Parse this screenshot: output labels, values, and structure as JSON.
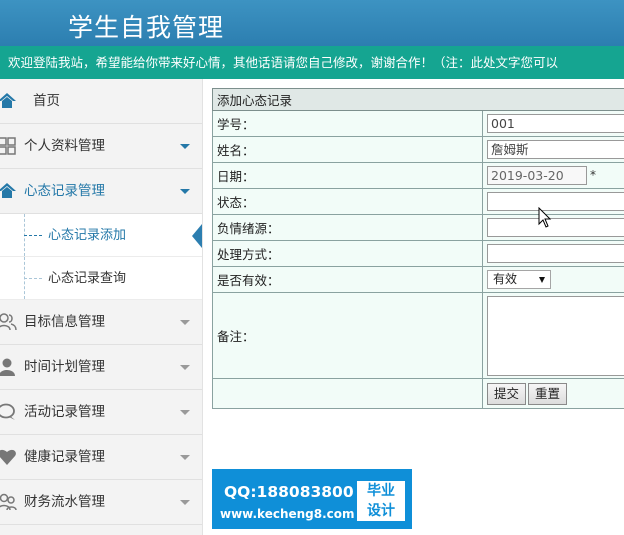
{
  "header": {
    "title": "学生自我管理"
  },
  "marquee": {
    "text": "欢迎登陆我站，希望能给你带来好心情，其他话语请您自己修改，谢谢合作！（注：此处文字您可以"
  },
  "sidebar": {
    "items": [
      {
        "label": "首页",
        "icon": "home-icon"
      },
      {
        "label": "个人资料管理",
        "icon": "grid-icon"
      },
      {
        "label": "心态记录管理",
        "icon": "home-icon"
      },
      {
        "label": "目标信息管理",
        "icon": "users-icon"
      },
      {
        "label": "时间计划管理",
        "icon": "user-icon"
      },
      {
        "label": "活动记录管理",
        "icon": "chat-icon"
      },
      {
        "label": "健康记录管理",
        "icon": "heart-icon"
      },
      {
        "label": "财务流水管理",
        "icon": "user-group-icon"
      }
    ],
    "sub_items": [
      {
        "label": "心态记录添加"
      },
      {
        "label": "心态记录查询"
      }
    ]
  },
  "form": {
    "caption": "添加心态记录",
    "student_id_label": "学号：",
    "student_id_value": "001",
    "name_label": "姓名：",
    "name_value": "詹姆斯",
    "date_label": "日期：",
    "date_value": "2019-03-20",
    "date_required": "*",
    "status_label": "状态：",
    "source_label": "负情绪源：",
    "method_label": "处理方式：",
    "valid_label": "是否有效：",
    "valid_value": "有效",
    "remark_label": "备注：",
    "submit_label": "提交",
    "reset_label": "重置"
  },
  "badge": {
    "qq": "QQ:188083800",
    "site": "www.kecheng8.com",
    "tag_line1": "毕业",
    "tag_line2": "设计"
  },
  "colors": {
    "header": "#2c7eb0",
    "marquee": "#15a591",
    "accent": "#2478a8",
    "form_bg": "#f2fcf8",
    "badge": "#0f8fd8"
  }
}
